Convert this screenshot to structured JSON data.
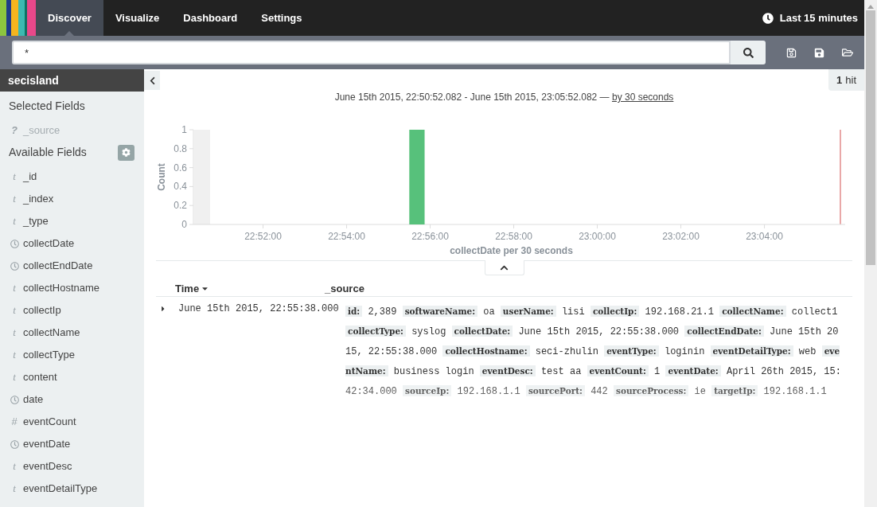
{
  "nav": {
    "tabs": [
      {
        "label": "Discover",
        "selected": true
      },
      {
        "label": "Visualize",
        "selected": false
      },
      {
        "label": "Dashboard",
        "selected": false
      },
      {
        "label": "Settings",
        "selected": false
      }
    ],
    "time_picker": "Last 15 minutes"
  },
  "search": {
    "value": "*"
  },
  "sidebar": {
    "index": "secisland",
    "selected_title": "Selected Fields",
    "selected_fields": [
      {
        "name": "_source",
        "kind": "unknown",
        "glyph": "?"
      }
    ],
    "available_title": "Available Fields",
    "available_fields": [
      {
        "name": "_id",
        "kind": "string",
        "glyph": "t"
      },
      {
        "name": "_index",
        "kind": "string",
        "glyph": "t"
      },
      {
        "name": "_type",
        "kind": "string",
        "glyph": "t"
      },
      {
        "name": "collectDate",
        "kind": "date"
      },
      {
        "name": "collectEndDate",
        "kind": "date"
      },
      {
        "name": "collectHostname",
        "kind": "string",
        "glyph": "t"
      },
      {
        "name": "collectIp",
        "kind": "string",
        "glyph": "t"
      },
      {
        "name": "collectName",
        "kind": "string",
        "glyph": "t"
      },
      {
        "name": "collectType",
        "kind": "string",
        "glyph": "t"
      },
      {
        "name": "content",
        "kind": "string",
        "glyph": "t"
      },
      {
        "name": "date",
        "kind": "date"
      },
      {
        "name": "eventCount",
        "kind": "number",
        "glyph": "#"
      },
      {
        "name": "eventDate",
        "kind": "date"
      },
      {
        "name": "eventDesc",
        "kind": "string",
        "glyph": "t"
      },
      {
        "name": "eventDetailType",
        "kind": "string",
        "glyph": "t"
      }
    ]
  },
  "hits": {
    "count": "1",
    "label": "hit"
  },
  "histogram": {
    "range": "June 15th 2015, 22:50:52.082 - June 15th 2015, 23:05:52.082 —",
    "interval": "by 30 seconds",
    "chart_data": {
      "type": "bar",
      "xlabel": "collectDate per 30 seconds",
      "ylabel": "Count",
      "categories": [
        null,
        null,
        null,
        "22:52:00",
        null,
        null,
        null,
        "22:54:00",
        null,
        null,
        null,
        "22:56:00",
        null,
        null,
        null,
        "22:58:00",
        null,
        null,
        null,
        "23:00:00",
        null,
        null,
        null,
        "23:02:00",
        null,
        null,
        null,
        "23:04:00",
        null,
        null,
        null
      ],
      "values": [
        null,
        null,
        null,
        null,
        null,
        null,
        null,
        null,
        null,
        null,
        1,
        null,
        null,
        null,
        null,
        null,
        null,
        null,
        null,
        null,
        null,
        null,
        null,
        null,
        null,
        null,
        null,
        null,
        null,
        null,
        null
      ],
      "ylim": [
        0,
        1
      ],
      "yticks": [
        0,
        0.2,
        0.4,
        0.6,
        0.8,
        1
      ]
    }
  },
  "table": {
    "columns": [
      "Time",
      "_source"
    ],
    "rows": [
      {
        "time": "June 15th 2015, 22:55:38.000",
        "expanded": false,
        "source": [
          {
            "key": "id:",
            "value": "2,389"
          },
          {
            "key": "softwareName:",
            "value": "oa"
          },
          {
            "key": "userName:",
            "value": "lisi"
          },
          {
            "key": "collectIp:",
            "value": "192.168.21.1"
          },
          {
            "key": "collectName:",
            "value": "collect1"
          },
          {
            "key": "collectType:",
            "value": "syslog"
          },
          {
            "key": "collectDate:",
            "value": "June 15th 2015, 22:55:38.000"
          },
          {
            "key": "collectEndDate:",
            "value": "June 15th 2015, 22:55:38.000"
          },
          {
            "key": "collectHostname:",
            "value": "seci-zhulin"
          },
          {
            "key": "eventType:",
            "value": "loginin"
          },
          {
            "key": "eventDetailType:",
            "value": "web"
          },
          {
            "key": "eventName:",
            "value": "business login"
          },
          {
            "key": "eventDesc:",
            "value": "test aa"
          },
          {
            "key": "eventCount:",
            "value": "1"
          },
          {
            "key": "eventDate:",
            "value": "April 26th 2015, 15:42:34.000"
          },
          {
            "key": "sourceIp:",
            "value": "192.168.1.1"
          },
          {
            "key": "sourcePort:",
            "value": "442"
          },
          {
            "key": "sourceProcess:",
            "value": "ie"
          },
          {
            "key": "targetIp:",
            "value": "192.168.1.1"
          }
        ]
      }
    ]
  }
}
